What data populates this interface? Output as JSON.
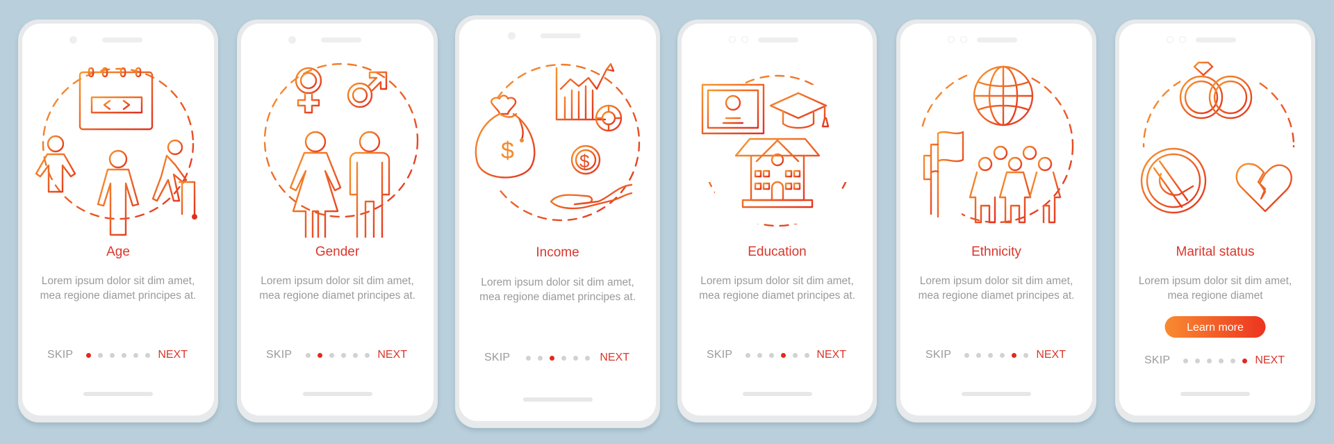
{
  "accent_color": "#d9362b",
  "gradient_colors": [
    "#f7922f",
    "#e5311f"
  ],
  "screens": [
    {
      "title": "Age",
      "description": "Lorem ipsum dolor sit dim amet, mea regione diamet principes at.",
      "skip_label": "SKIP",
      "next_label": "NEXT",
      "active_page": 1,
      "total_pages": 6,
      "illustration": "age-groups-icon"
    },
    {
      "title": "Gender",
      "description": "Lorem ipsum dolor sit dim amet, mea regione diamet principes at.",
      "skip_label": "SKIP",
      "next_label": "NEXT",
      "active_page": 2,
      "total_pages": 6,
      "illustration": "gender-icon"
    },
    {
      "title": "Income",
      "description": "Lorem ipsum dolor sit dim amet, mea regione diamet principes at.",
      "skip_label": "SKIP",
      "next_label": "NEXT",
      "active_page": 3,
      "total_pages": 6,
      "illustration": "income-icon"
    },
    {
      "title": "Education",
      "description": "Lorem ipsum dolor sit dim amet, mea regione diamet principes at.",
      "skip_label": "SKIP",
      "next_label": "NEXT",
      "active_page": 4,
      "total_pages": 6,
      "illustration": "education-icon"
    },
    {
      "title": "Ethnicity",
      "description": "Lorem ipsum dolor sit dim amet, mea regione diamet principes at.",
      "skip_label": "SKIP",
      "next_label": "NEXT",
      "active_page": 5,
      "total_pages": 6,
      "illustration": "ethnicity-icon"
    },
    {
      "title": "Marital status",
      "description": "Lorem ipsum dolor sit dim amet, mea regione diamet",
      "skip_label": "SKIP",
      "next_label": "NEXT",
      "active_page": 6,
      "total_pages": 6,
      "illustration": "marital-status-icon",
      "button_label": "Learn more"
    }
  ]
}
